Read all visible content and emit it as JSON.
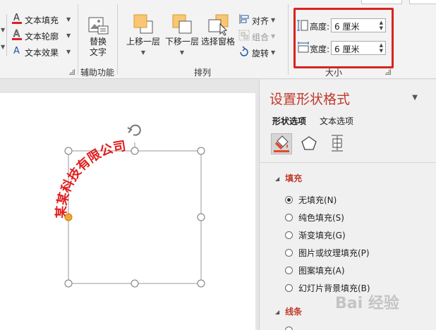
{
  "ribbon": {
    "text_fill": "文本填充",
    "text_outline": "文本轮廓",
    "text_effect": "文本效果",
    "replace_text": [
      "替换",
      "文字"
    ],
    "group_accessibility": "辅助功能",
    "bring_forward": "上移一层",
    "send_backward": "下移一层",
    "selection_pane": "选择窗格",
    "align": "对齐",
    "group": "组合",
    "rotate": "旋转",
    "group_arrange": "排列",
    "height_label": "高度:",
    "height_value": "6 厘米",
    "width_label": "宽度:",
    "width_value": "6 厘米",
    "group_size": "大小"
  },
  "slide": {
    "arc_text": "某某科技有限公司"
  },
  "pane": {
    "title": "设置形状格式",
    "tabs": [
      "形状选项",
      "文本选项"
    ],
    "section_fill": "填充",
    "fill_options": [
      {
        "label": "无填充(N)",
        "checked": true
      },
      {
        "label": "纯色填充(S)",
        "checked": false
      },
      {
        "label": "渐变填充(G)",
        "checked": false
      },
      {
        "label": "图片或纹理填充(P)",
        "checked": false
      },
      {
        "label": "图案填充(A)",
        "checked": false
      },
      {
        "label": "幻灯片背景填充(B)",
        "checked": false
      }
    ],
    "section_line": "线条"
  },
  "watermark": "Bai 经验",
  "colors": {
    "accent_red": "#c1392b",
    "highlight_box": "#d9231e",
    "arc_text": "#e11d1d",
    "shape_icon_fill": "#f9c773",
    "shape_icon_border": "#d99a2b"
  }
}
